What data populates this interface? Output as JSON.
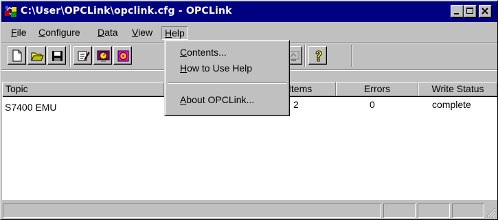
{
  "window": {
    "title": "C:\\User\\OPCLink\\opclink.cfg - OPCLink",
    "title_bar_color": "#000080",
    "face_color": "#c0c0c0"
  },
  "menu": {
    "items": [
      {
        "label_first": "F",
        "label_rest": "ile"
      },
      {
        "label_first": "C",
        "label_rest": "onfigure"
      },
      {
        "label_first": "D",
        "label_rest": "ata"
      },
      {
        "label_first": "V",
        "label_rest": "iew"
      },
      {
        "label_first": "H",
        "label_rest": "elp"
      }
    ],
    "active": "Help"
  },
  "help_menu": {
    "contents": {
      "first": "C",
      "rest": "ontents..."
    },
    "how_to": {
      "first": "H",
      "rest": "ow to Use Help"
    },
    "about": {
      "first": "A",
      "rest": "bout OPCLink..."
    }
  },
  "toolbar": {
    "buttons": [
      "new-file-icon",
      "open-folder-icon",
      "save-disk-icon",
      "edit-document-icon",
      "topic-definition-icon",
      "data-icon",
      "server-icon",
      "help-question-icon"
    ]
  },
  "list": {
    "columns": [
      "Topic",
      "Items",
      "Errors",
      "Write Status"
    ],
    "rows": [
      {
        "topic": "S7400 EMU",
        "items": "2",
        "errors": "0",
        "write_status": "complete"
      }
    ]
  }
}
